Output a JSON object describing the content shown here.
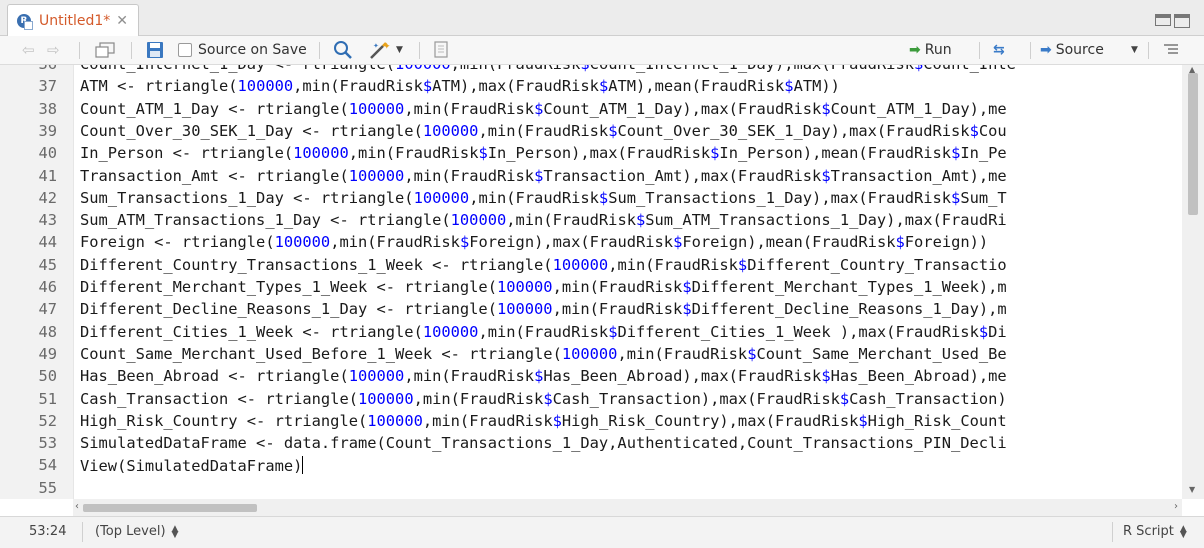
{
  "tab": {
    "title": "Untitled1*"
  },
  "toolbar": {
    "source_on_save": "Source on Save",
    "run": "Run",
    "source": "Source"
  },
  "editor": {
    "lines": [
      {
        "num": "36",
        "text": "Count_Internet_1_Day <- rtriangle(100000,min(FraudRisk$Count_Internet_1_Day),max(FraudRisk$Count_Inte"
      },
      {
        "num": "37",
        "text": "ATM <- rtriangle(100000,min(FraudRisk$ATM),max(FraudRisk$ATM),mean(FraudRisk$ATM))"
      },
      {
        "num": "38",
        "text": "Count_ATM_1_Day <- rtriangle(100000,min(FraudRisk$Count_ATM_1_Day),max(FraudRisk$Count_ATM_1_Day),me"
      },
      {
        "num": "39",
        "text": "Count_Over_30_SEK_1_Day <- rtriangle(100000,min(FraudRisk$Count_Over_30_SEK_1_Day),max(FraudRisk$Cou"
      },
      {
        "num": "40",
        "text": "In_Person <- rtriangle(100000,min(FraudRisk$In_Person),max(FraudRisk$In_Person),mean(FraudRisk$In_Pe"
      },
      {
        "num": "41",
        "text": "Transaction_Amt <- rtriangle(100000,min(FraudRisk$Transaction_Amt),max(FraudRisk$Transaction_Amt),me"
      },
      {
        "num": "42",
        "text": "Sum_Transactions_1_Day <- rtriangle(100000,min(FraudRisk$Sum_Transactions_1_Day),max(FraudRisk$Sum_T"
      },
      {
        "num": "43",
        "text": "Sum_ATM_Transactions_1_Day <- rtriangle(100000,min(FraudRisk$Sum_ATM_Transactions_1_Day),max(FraudRi"
      },
      {
        "num": "44",
        "text": "Foreign <- rtriangle(100000,min(FraudRisk$Foreign),max(FraudRisk$Foreign),mean(FraudRisk$Foreign))"
      },
      {
        "num": "45",
        "text": "Different_Country_Transactions_1_Week <- rtriangle(100000,min(FraudRisk$Different_Country_Transactio"
      },
      {
        "num": "46",
        "text": "Different_Merchant_Types_1_Week <- rtriangle(100000,min(FraudRisk$Different_Merchant_Types_1_Week),m"
      },
      {
        "num": "47",
        "text": "Different_Decline_Reasons_1_Day <- rtriangle(100000,min(FraudRisk$Different_Decline_Reasons_1_Day),m"
      },
      {
        "num": "48",
        "text": "Different_Cities_1_Week <- rtriangle(100000,min(FraudRisk$Different_Cities_1_Week ),max(FraudRisk$Di"
      },
      {
        "num": "49",
        "text": "Count_Same_Merchant_Used_Before_1_Week <- rtriangle(100000,min(FraudRisk$Count_Same_Merchant_Used_Be"
      },
      {
        "num": "50",
        "text": "Has_Been_Abroad <- rtriangle(100000,min(FraudRisk$Has_Been_Abroad),max(FraudRisk$Has_Been_Abroad),me"
      },
      {
        "num": "51",
        "text": "Cash_Transaction <- rtriangle(100000,min(FraudRisk$Cash_Transaction),max(FraudRisk$Cash_Transaction)"
      },
      {
        "num": "52",
        "text": "High_Risk_Country <- rtriangle(100000,min(FraudRisk$High_Risk_Country),max(FraudRisk$High_Risk_Count"
      },
      {
        "num": "53",
        "text": "SimulatedDataFrame <- data.frame(Count_Transactions_1_Day,Authenticated,Count_Transactions_PIN_Decli"
      },
      {
        "num": "54",
        "text": "View(SimulatedDataFrame)"
      },
      {
        "num": "55",
        "text": ""
      }
    ]
  },
  "status": {
    "cursor_position": "53:24",
    "scope": "(Top Level)",
    "file_type": "R Script"
  },
  "colors": {
    "number": "#0000ff",
    "dollar": "#0000ff",
    "tab_title": "#d45a2a"
  }
}
